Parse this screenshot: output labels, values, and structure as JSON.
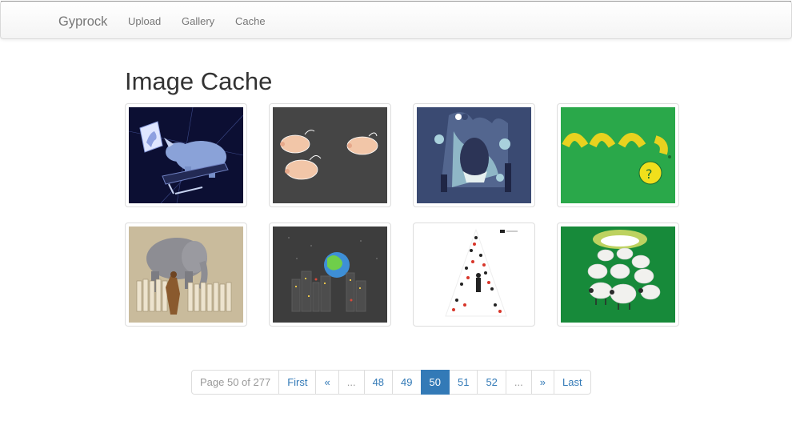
{
  "navbar": {
    "brand": "Gyprock",
    "links": [
      "Upload",
      "Gallery",
      "Cache"
    ]
  },
  "page": {
    "title": "Image Cache"
  },
  "gallery": {
    "images": [
      {
        "icon": "rhino-treadmill-unicorn-icon",
        "bg": "#0c0f33"
      },
      {
        "icon": "flying-pigs-icon",
        "bg": "#454545"
      },
      {
        "icon": "forest-creatures-icon",
        "bg": "#3a4a72"
      },
      {
        "icon": "macaroni-question-icon",
        "bg": "#2aa84a"
      },
      {
        "icon": "elephant-fence-icon",
        "bg": "#c9bb9c"
      },
      {
        "icon": "earth-city-icon",
        "bg": "#3d3d3d"
      },
      {
        "icon": "triangle-tree-pattern-icon",
        "bg": "#ffffff"
      },
      {
        "icon": "sheep-flock-icon",
        "bg": "#178a3a"
      }
    ]
  },
  "pagination": {
    "status": "Page 50 of 277",
    "first": "First",
    "prev": "«",
    "ellipsis": "...",
    "pages": [
      "48",
      "49",
      "50",
      "51",
      "52"
    ],
    "current": "50",
    "next": "»",
    "last": "Last"
  }
}
